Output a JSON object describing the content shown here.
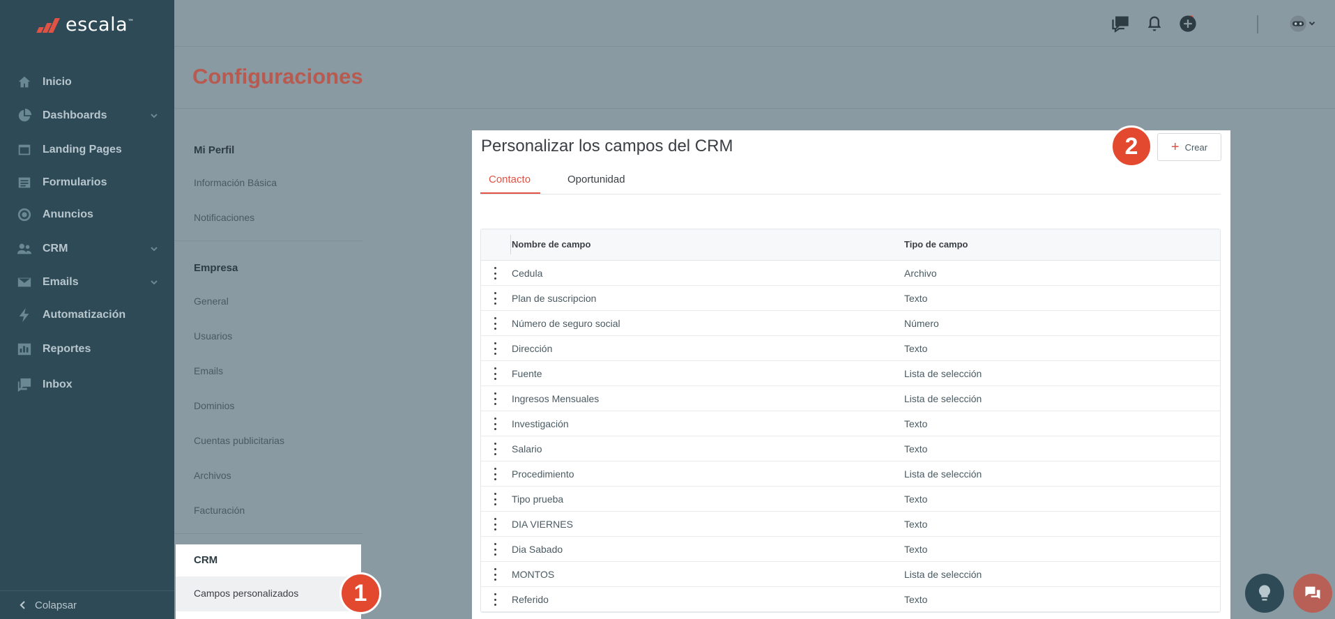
{
  "brand": {
    "name": "escala",
    "tm": "™"
  },
  "sidebar": {
    "items": [
      {
        "label": "Inicio",
        "icon": "home-icon",
        "expandable": false
      },
      {
        "label": "Dashboards",
        "icon": "pie-chart-icon",
        "expandable": true
      },
      {
        "label": "Landing Pages",
        "icon": "browser-icon",
        "expandable": false
      },
      {
        "label": "Formularios",
        "icon": "form-icon",
        "expandable": false
      },
      {
        "label": "Anuncios",
        "icon": "target-icon",
        "expandable": false
      },
      {
        "label": "CRM",
        "icon": "users-icon",
        "expandable": true
      },
      {
        "label": "Emails",
        "icon": "mail-icon",
        "expandable": true
      },
      {
        "label": "Automatización",
        "icon": "bolt-icon",
        "expandable": false
      },
      {
        "label": "Reportes",
        "icon": "bar-chart-icon",
        "expandable": false
      },
      {
        "label": "Inbox",
        "icon": "inbox-icon",
        "expandable": false
      }
    ],
    "collapse_label": "Colapsar"
  },
  "topbar": {
    "icons": [
      "chat-icon",
      "bell-icon",
      "plus-circle-icon",
      "avatar"
    ]
  },
  "page": {
    "title": "Configuraciones"
  },
  "settings_menu": {
    "profile": {
      "heading": "Mi Perfil",
      "items": [
        "Información Básica",
        "Notificaciones"
      ]
    },
    "company": {
      "heading": "Empresa",
      "items": [
        "General",
        "Usuarios",
        "Emails",
        "Dominios",
        "Cuentas publicitarias",
        "Archivos",
        "Facturación"
      ]
    },
    "crm": {
      "heading": "CRM",
      "active_item": "Campos personalizados"
    }
  },
  "callouts": [
    "1",
    "2"
  ],
  "panel": {
    "title": "Personalizar los campos del CRM",
    "create_label": "Crear",
    "tabs": [
      "Contacto",
      "Oportunidad"
    ],
    "table": {
      "headers": [
        "Nombre de campo",
        "Tipo de campo"
      ],
      "rows": [
        [
          "Cedula",
          "Archivo"
        ],
        [
          "Plan de suscripcion",
          "Texto"
        ],
        [
          "Número de seguro social",
          "Número"
        ],
        [
          "Dirección",
          "Texto"
        ],
        [
          "Fuente",
          "Lista de selección"
        ],
        [
          "Ingresos Mensuales",
          "Lista de selección"
        ],
        [
          "Investigación",
          "Texto"
        ],
        [
          "Salario",
          "Texto"
        ],
        [
          "Procedimiento",
          "Lista de selección"
        ],
        [
          "Tipo prueba",
          "Texto"
        ],
        [
          "DIA VIERNES",
          "Texto"
        ],
        [
          "Dia Sabado",
          "Texto"
        ],
        [
          "MONTOS",
          "Lista de selección"
        ],
        [
          "Referido",
          "Texto"
        ]
      ]
    }
  },
  "colors": {
    "accent": "#e05243",
    "sidebar": "#2e4a57",
    "overlay": "#8a9aa2"
  }
}
